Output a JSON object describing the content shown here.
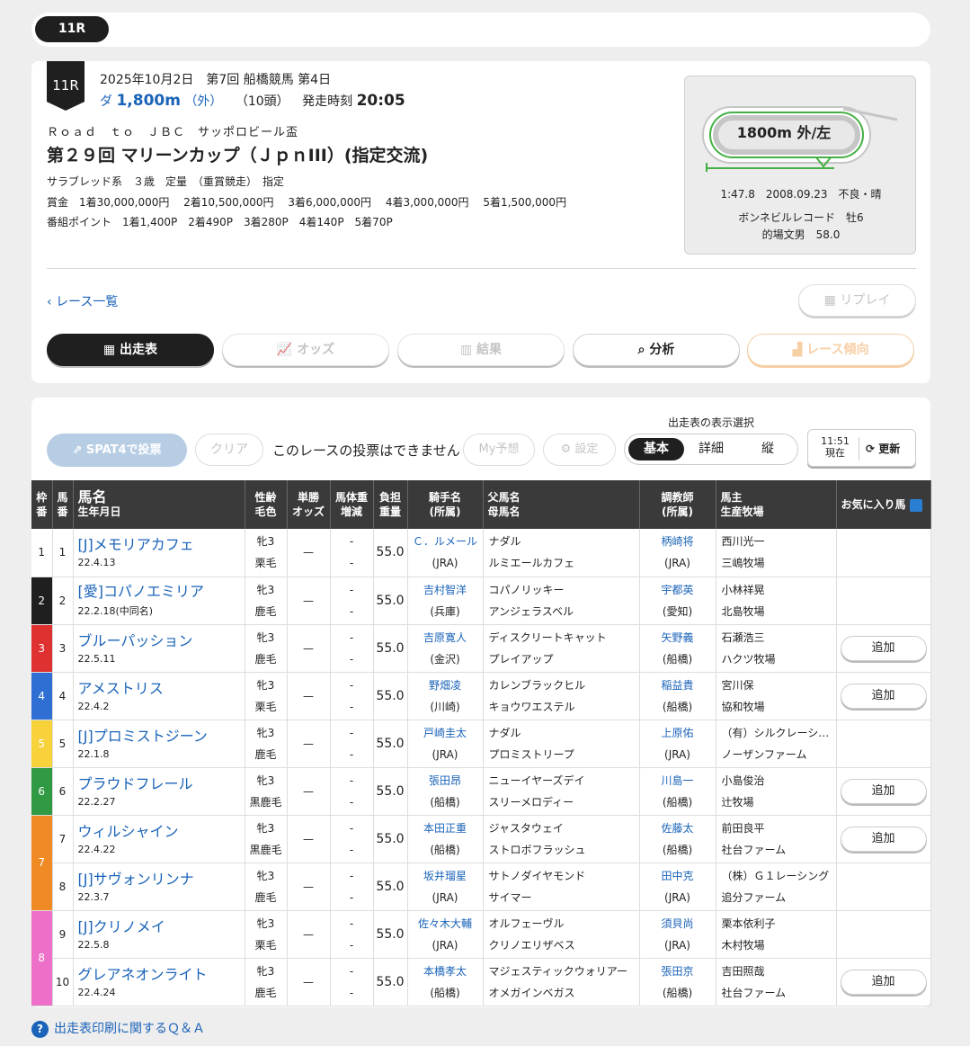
{
  "topbar": {
    "race_pill": "11R"
  },
  "header": {
    "race_no": "11R",
    "date_line": "2025年10月2日　第7回 船橋競馬 第4日",
    "surface": "ダ",
    "distance": "1,800m",
    "direction": "（外）",
    "runners": "（10頭）",
    "post_time_label": "発走時刻",
    "post_time": "20:05",
    "subtitle": "Ｒｏａｄ　ｔｏ　ＪＢＣ　サッポロビール盃",
    "title": "第２９回 マリーンカップ（ＪｐｎIII）(指定交流)",
    "conditions": "サラブレッド系　３歳　定量　（重賞競走）　指定",
    "prize": "賞金　1着30,000,000円　 2着10,500,000円　 3着6,000,000円　 4着3,000,000円　 5着1,500,000円",
    "points": "番組ポイント　1着1,400P　2着490P　3着280P　4着140P　5着70P"
  },
  "course": {
    "label": "1800m 外/左",
    "record_line": "1:47.8　2008.09.23　不良・晴",
    "record_horse": "ボンネビルレコード　牡6",
    "record_jockey": "的場文男　58.0"
  },
  "nav": {
    "back": "レース一覧",
    "replay": "リプレイ"
  },
  "tabs": [
    {
      "label": "出走表"
    },
    {
      "label": "オッズ"
    },
    {
      "label": "結果"
    },
    {
      "label": "分析"
    },
    {
      "label": "レース傾向"
    }
  ],
  "toolbar": {
    "spat4": "SPAT4で投票",
    "clear": "クリア",
    "no_vote": "このレースの投票はできません",
    "my_pred": "My予想",
    "settings": "設定",
    "display_label": "出走表の表示選択",
    "views": [
      "基本",
      "詳細",
      "縦"
    ],
    "time": "11:51",
    "now": "現在",
    "update": "更新"
  },
  "table": {
    "headers": {
      "waku": "枠番",
      "uma": "馬番",
      "name": "馬名",
      "birth": "生年月日",
      "sex": "性齢",
      "color": "毛色",
      "odds1": "単勝",
      "odds2": "オッズ",
      "wt1": "馬体重",
      "wt2": "増減",
      "load1": "負担",
      "load2": "重量",
      "jockey": "騎手名",
      "jaff": "(所属)",
      "sire": "父馬名",
      "dam": "母馬名",
      "trainer": "調教師",
      "taff": "(所属)",
      "owner": "馬主",
      "breeder": "生産牧場",
      "fav": "お気に入り馬"
    },
    "fav_label": "追加",
    "rows": [
      {
        "waku": "1",
        "uma": "1",
        "name": "[J]メモリアカフェ",
        "birth": "22.4.13",
        "sex": "牝3",
        "color": "栗毛",
        "odds": "—",
        "wt": "-",
        "wtd": "-",
        "load": "55.0",
        "jockey": "Ｃ．ルメール",
        "jaff": "(JRA)",
        "sire": "ナダル",
        "dam": "ルミエールカフェ",
        "trainer": "柄崎将",
        "taff": "(JRA)",
        "owner": "西川光一",
        "breeder": "三嶋牧場"
      },
      {
        "waku": "2",
        "uma": "2",
        "name": "[愛]コパノエミリア",
        "birth": "22.2.18(中同名)",
        "sex": "牝3",
        "color": "鹿毛",
        "odds": "—",
        "wt": "-",
        "wtd": "-",
        "load": "55.0",
        "jockey": "吉村智洋",
        "jaff": "(兵庫)",
        "sire": "コパノリッキー",
        "dam": "アンジェラスベル",
        "trainer": "宇都英",
        "taff": "(愛知)",
        "owner": "小林祥晃",
        "breeder": "北島牧場"
      },
      {
        "waku": "3",
        "uma": "3",
        "name": "ブルーパッション",
        "birth": "22.5.11",
        "sex": "牝3",
        "color": "鹿毛",
        "odds": "—",
        "wt": "-",
        "wtd": "-",
        "load": "55.0",
        "jockey": "吉原寛人",
        "jaff": "(金沢)",
        "sire": "ディスクリートキャット",
        "dam": "プレイアップ",
        "trainer": "矢野義",
        "taff": "(船橋)",
        "owner": "石瀬浩三",
        "breeder": "ハクツ牧場"
      },
      {
        "waku": "4",
        "uma": "4",
        "name": "アメストリス",
        "birth": "22.4.2",
        "sex": "牝3",
        "color": "栗毛",
        "odds": "—",
        "wt": "-",
        "wtd": "-",
        "load": "55.0",
        "jockey": "野畑凌",
        "jaff": "(川崎)",
        "sire": "カレンブラックヒル",
        "dam": "キョウワエステル",
        "trainer": "稲益貴",
        "taff": "(船橋)",
        "owner": "宮川保",
        "breeder": "協和牧場"
      },
      {
        "waku": "5",
        "uma": "5",
        "name": "[J]プロミストジーン",
        "birth": "22.1.8",
        "sex": "牝3",
        "color": "鹿毛",
        "odds": "—",
        "wt": "-",
        "wtd": "-",
        "load": "55.0",
        "jockey": "戸崎圭太",
        "jaff": "(JRA)",
        "sire": "ナダル",
        "dam": "プロミストリープ",
        "trainer": "上原佑",
        "taff": "(JRA)",
        "owner": "（有）シルクレーシング",
        "breeder": "ノーザンファーム"
      },
      {
        "waku": "6",
        "uma": "6",
        "name": "プラウドフレール",
        "birth": "22.2.27",
        "sex": "牝3",
        "color": "黒鹿毛",
        "odds": "—",
        "wt": "-",
        "wtd": "-",
        "load": "55.0",
        "jockey": "張田昂",
        "jaff": "(船橋)",
        "sire": "ニューイヤーズデイ",
        "dam": "スリーメロディー",
        "trainer": "川島一",
        "taff": "(船橋)",
        "owner": "小島俊治",
        "breeder": "辻牧場"
      },
      {
        "waku": "7",
        "uma": "7",
        "name": "ウィルシャイン",
        "birth": "22.4.22",
        "sex": "牝3",
        "color": "黒鹿毛",
        "odds": "—",
        "wt": "-",
        "wtd": "-",
        "load": "55.0",
        "jockey": "本田正重",
        "jaff": "(船橋)",
        "sire": "ジャスタウェイ",
        "dam": "ストロボフラッシュ",
        "trainer": "佐藤太",
        "taff": "(船橋)",
        "owner": "前田良平",
        "breeder": "社台ファーム"
      },
      {
        "waku": "7",
        "uma": "8",
        "name": "[J]サヴォンリンナ",
        "birth": "22.3.7",
        "sex": "牝3",
        "color": "鹿毛",
        "odds": "—",
        "wt": "-",
        "wtd": "-",
        "load": "55.0",
        "jockey": "坂井瑠星",
        "jaff": "(JRA)",
        "sire": "サトノダイヤモンド",
        "dam": "サイマー",
        "trainer": "田中克",
        "taff": "(JRA)",
        "owner": "（株）Ｇ１レーシング",
        "breeder": "追分ファーム"
      },
      {
        "waku": "8",
        "uma": "9",
        "name": "[J]クリノメイ",
        "birth": "22.5.8",
        "sex": "牝3",
        "color": "栗毛",
        "odds": "—",
        "wt": "-",
        "wtd": "-",
        "load": "55.0",
        "jockey": "佐々木大輔",
        "jaff": "(JRA)",
        "sire": "オルフェーヴル",
        "dam": "クリノエリザベス",
        "trainer": "須貝尚",
        "taff": "(JRA)",
        "owner": "栗本依利子",
        "breeder": "木村牧場"
      },
      {
        "waku": "8",
        "uma": "10",
        "name": "グレアネオンライト",
        "birth": "22.4.24",
        "sex": "牝3",
        "color": "鹿毛",
        "odds": "—",
        "wt": "-",
        "wtd": "-",
        "load": "55.0",
        "jockey": "本橋孝太",
        "jaff": "(船橋)",
        "sire": "マジェスティックウォリアー",
        "dam": "オメガインベガス",
        "trainer": "張田京",
        "taff": "(船橋)",
        "owner": "吉田照哉",
        "breeder": "社台ファーム"
      }
    ]
  },
  "faq": {
    "icon": "?",
    "text": "出走表印刷に関するＱ＆Ａ"
  }
}
